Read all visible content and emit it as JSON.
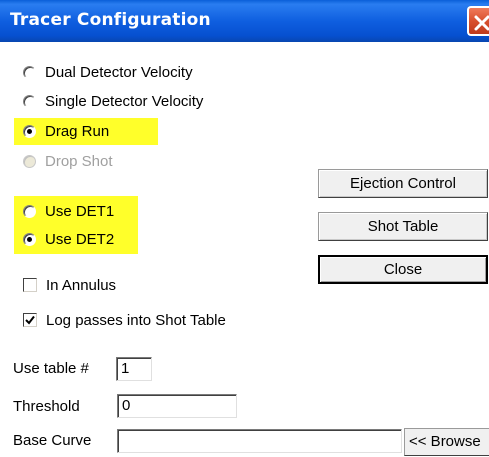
{
  "window": {
    "title": "Tracer Configuration",
    "close_icon": "close-x-icon",
    "colors": {
      "titlebar": "#0f5fe0",
      "close_button": "#d8502e",
      "highlight": "#ffff2a"
    }
  },
  "modes": {
    "dual_detector_velocity": {
      "label": "Dual Detector Velocity",
      "checked": false,
      "enabled": true
    },
    "single_detector_velocity": {
      "label": "Single Detector Velocity",
      "checked": false,
      "enabled": true
    },
    "drag_run": {
      "label": "Drag Run",
      "checked": true,
      "enabled": true
    },
    "drop_shot": {
      "label": "Drop Shot",
      "checked": false,
      "enabled": false
    }
  },
  "detectors": {
    "use_det1": {
      "label": "Use DET1",
      "checked": false
    },
    "use_det2": {
      "label": "Use DET2",
      "checked": true
    }
  },
  "options": {
    "in_annulus": {
      "label": "In Annulus",
      "checked": false
    },
    "log_passes": {
      "label": "Log passes into Shot Table",
      "checked": true
    }
  },
  "buttons": {
    "ejection_control": "Ejection Control",
    "shot_table": "Shot Table",
    "close": "Close",
    "browse": "<< Browse"
  },
  "fields": {
    "use_table": {
      "label": "Use table #",
      "value": "1"
    },
    "threshold": {
      "label": "Threshold",
      "value": "0"
    },
    "base_curve": {
      "label": "Base Curve",
      "value": ""
    }
  }
}
